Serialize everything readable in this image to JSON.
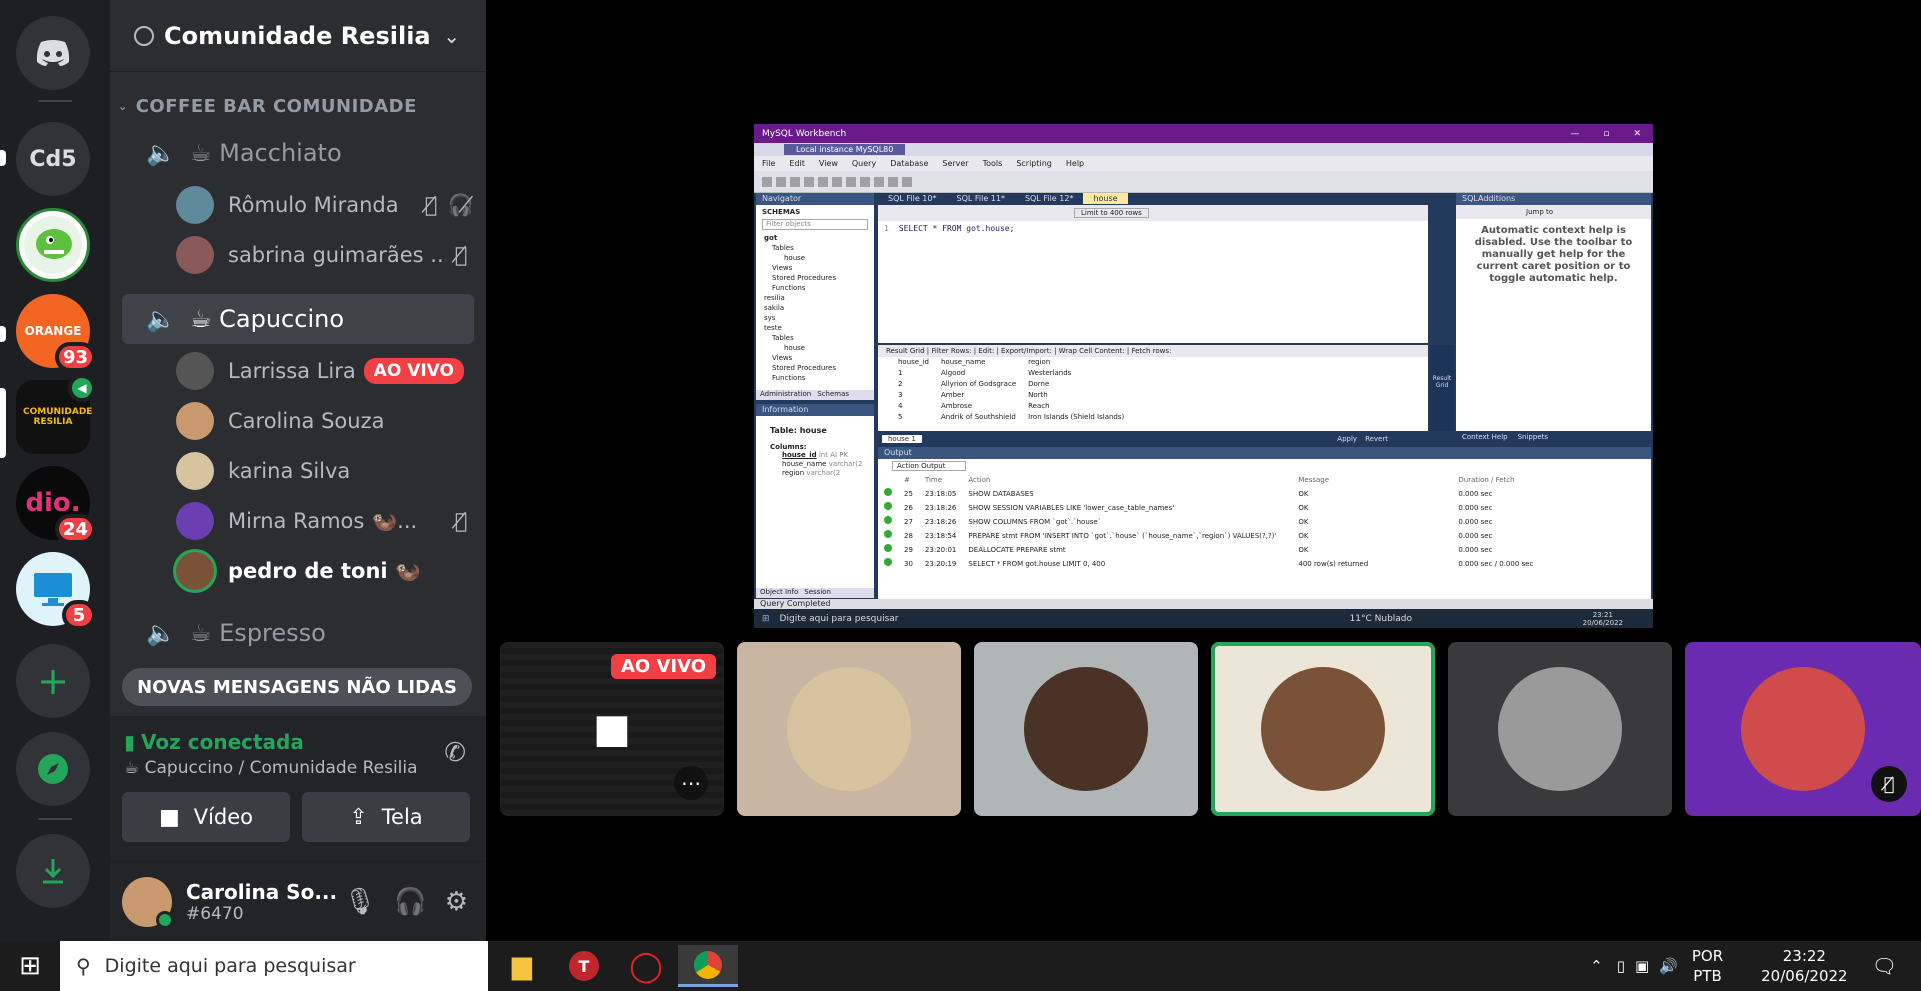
{
  "server_rail": {
    "servers": [
      {
        "name": "home",
        "icon": "discord-icon"
      },
      {
        "label": "Cd5"
      },
      {
        "name": "dino-server",
        "icon": "dinosaur-icon"
      },
      {
        "name": "orange-server",
        "label": "ORANGE",
        "badge": "93"
      },
      {
        "name": "comunidade-resilia",
        "label": "COMUNIDADE RESILIA"
      },
      {
        "name": "dio-server",
        "label": "dio.",
        "badge": "24"
      },
      {
        "name": "monitor-server",
        "icon": "monitor-icon",
        "badge": "5"
      }
    ],
    "add_server": "plus-icon",
    "explore": "compass-icon",
    "download": "download-icon"
  },
  "server": {
    "name": "Comunidade Resilia"
  },
  "category": {
    "name": "COFFEE BAR COMUNIDADE"
  },
  "voice_channels": [
    {
      "name": "☕ Macchiato",
      "users": [
        {
          "name": "Rômulo Miranda",
          "muted": true,
          "deafened": true
        },
        {
          "name": "sabrina guimarães ...",
          "muted": true
        }
      ]
    },
    {
      "name": "☕ Capuccino",
      "active": true,
      "users": [
        {
          "name": "Larrissa Lira",
          "live": "AO VIVO"
        },
        {
          "name": "Carolina Souza"
        },
        {
          "name": "karina Silva"
        },
        {
          "name": "Mirna Ramos 🦦...",
          "muted": true
        },
        {
          "name": "pedro de toni 🦦",
          "speaking": true
        }
      ]
    },
    {
      "name": "☕ Espresso",
      "users": []
    }
  ],
  "unread_banner": "NOVAS MENSAGENS NÃO LIDAS",
  "voice_status": {
    "title": "Voz conectada",
    "subtitle": "☕ Capuccino / Comunidade Resilia",
    "video_label": "Vídeo",
    "screen_label": "Tela"
  },
  "user": {
    "name": "Carolina So...",
    "tag": "#6470"
  },
  "shared_screen": {
    "app_title": "MySQL Workbench",
    "instance_tab": "Local instance MySQL80",
    "menu": [
      "File",
      "Edit",
      "View",
      "Query",
      "Database",
      "Server",
      "Tools",
      "Scripting",
      "Help"
    ],
    "navigator": "Navigator",
    "schemas_label": "SCHEMAS",
    "filter_placeholder": "Filter objects",
    "tree": [
      "got",
      "Tables",
      "house",
      "Views",
      "Stored Procedures",
      "Functions",
      "resilia",
      "sakila",
      "sys",
      "teste",
      "Tables",
      "house",
      "Views",
      "Stored Procedures",
      "Functions"
    ],
    "nav_tabs": [
      "Administration",
      "Schemas"
    ],
    "info_header": "Information",
    "info_table": "Table: house",
    "info_columns_label": "Columns:",
    "info_columns": [
      [
        "house_id",
        "int AI PK"
      ],
      [
        "house_name",
        "varchar(2"
      ],
      [
        "region",
        "varchar(2"
      ]
    ],
    "info_tabs": [
      "Object Info",
      "Session"
    ],
    "sql_tabs": [
      "SQL File 10*",
      "SQL File 11*",
      "SQL File 12*",
      "house"
    ],
    "limit_label": "Limit to 400 rows",
    "query": "SELECT * FROM got.house;",
    "result_bar": "Result Grid | Filter Rows: | Edit: | Export/Import: | Wrap Cell Content: | Fetch rows:",
    "result_columns": [
      "house_id",
      "house_name",
      "region"
    ],
    "result_rows": [
      [
        "1",
        "Algood",
        "Westerlands"
      ],
      [
        "2",
        "Allyrion of Godsgrace",
        "Dorne"
      ],
      [
        "3",
        "Amber",
        "North"
      ],
      [
        "4",
        "Ambrose",
        "Reach"
      ],
      [
        "5",
        "Andrik of Southshield",
        "Iron Islands (Shield Islands)"
      ]
    ],
    "result_tab": "house 1",
    "apply_label": "Apply",
    "revert_label": "Revert",
    "result_side": "Result Grid",
    "sqladditions": "SQLAdditions",
    "jump_to": "Jump to",
    "help_text": "Automatic context help is disabled. Use the toolbar to manually get help for the current caret position or to toggle automatic help.",
    "help_tabs": [
      "Context Help",
      "Snippets"
    ],
    "output_header": "Output",
    "action_output": "Action Output",
    "output_columns": [
      "#",
      "Time",
      "Action",
      "Message",
      "Duration / Fetch"
    ],
    "output_rows": [
      [
        "25",
        "23:18:05",
        "SHOW DATABASES",
        "OK",
        "0.000 sec"
      ],
      [
        "26",
        "23:18:26",
        "SHOW SESSION VARIABLES LIKE 'lower_case_table_names'",
        "OK",
        "0.000 sec"
      ],
      [
        "27",
        "23:18:26",
        "SHOW COLUMNS FROM `got`.`house`",
        "OK",
        "0.000 sec"
      ],
      [
        "28",
        "23:18:54",
        "PREPARE stmt FROM 'INSERT INTO `got`.`house` (`house_name`,`region`) VALUES(?,?)'",
        "OK",
        "0.000 sec"
      ],
      [
        "29",
        "23:20:01",
        "DEALLOCATE PREPARE stmt",
        "OK",
        "0.000 sec"
      ],
      [
        "30",
        "23:20:19",
        "SELECT * FROM got.house LIMIT 0, 400",
        "400 row(s) returned",
        "0.000 sec / 0.000 sec"
      ]
    ],
    "status": "Query Completed",
    "inner_search": "Digite aqui para pesquisar",
    "inner_weather": "11°C Nublado",
    "inner_time": "23:21",
    "inner_date": "20/06/2022"
  },
  "tiles": [
    {
      "name": "screen-share-tile",
      "live": "AO VIVO",
      "bg": "#1a1a1a"
    },
    {
      "name": "participant-tile",
      "bg": "#c9b6a2",
      "face": "#d8c3a0"
    },
    {
      "name": "participant-tile",
      "bg": "#b0b6b6",
      "face": "#4a3226"
    },
    {
      "name": "participant-tile-speaking",
      "bg": "#ece6d8",
      "face": "#7a5238"
    },
    {
      "name": "participant-tile",
      "bg": "#3a3a3c",
      "face": "#9a9a9a"
    },
    {
      "name": "participant-tile",
      "bg": "#6b2bb1",
      "face": "#d04b4b",
      "muted": true
    }
  ],
  "taskbar": {
    "search_placeholder": "Digite aqui para pesquisar",
    "lang": "POR",
    "layout": "PTB",
    "time": "23:22",
    "date": "20/06/2022"
  }
}
